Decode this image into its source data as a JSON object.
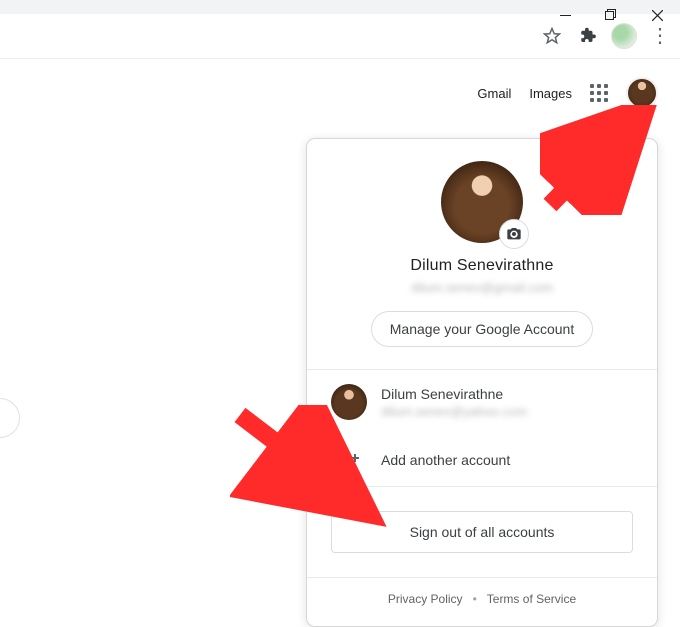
{
  "window": {
    "minimize_tip": "Minimize",
    "restore_tip": "Restore",
    "close_tip": "Close"
  },
  "addrbar": {
    "star_tip": "Bookmark this tab",
    "ext_tip": "Extensions",
    "profile_tip": "Profile",
    "menu_tip": "Customize and control Google Chrome"
  },
  "gnav": {
    "gmail": "Gmail",
    "images": "Images",
    "apps_tip": "Google apps",
    "account_tip": "Google Account"
  },
  "popup": {
    "name": "Dilum Senevirathne",
    "email": "dilum.senev@gmail.com",
    "camera_tip": "Change profile picture",
    "manage_label": "Manage your Google Account",
    "accounts": [
      {
        "name": "Dilum Senevirathne",
        "email": "dilum.senev@yahoo.com"
      }
    ],
    "add_account_label": "Add another account",
    "signout_label": "Sign out of all accounts",
    "privacy_label": "Privacy Policy",
    "terms_label": "Terms of Service"
  }
}
